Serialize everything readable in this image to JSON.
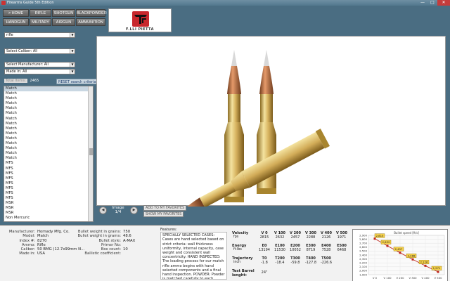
{
  "window": {
    "title": "Firearms Guide 5th Edition",
    "controls": [
      "—",
      "□",
      "✕"
    ]
  },
  "nav": {
    "row1": [
      "> HOME",
      "RIFLE",
      "SHOTGUN",
      "BLACKPOWDER"
    ],
    "row2": [
      "HANDGUN",
      "MILITARY",
      "AIRGUN",
      "AMMUNITION"
    ]
  },
  "logo": {
    "text": "F.LLI PIETTA"
  },
  "filters": {
    "type_select": "rifle",
    "caliber_select": "Select Caliber: All",
    "manufacturer_select": "Select Manufacturer: All",
    "made_in_select": "Made in: All",
    "count_label": "Total Items:",
    "count_value": "2465",
    "reset_label": "RESET search criteria"
  },
  "list": {
    "items": [
      "Match",
      "Match",
      "Match",
      "Match",
      "Match",
      "Match",
      "Match",
      "Match",
      "Match",
      "Match",
      "Match",
      "Match",
      "Match",
      "Match",
      "Match",
      "MFS",
      "MFS",
      "MFS",
      "MFS",
      "MFS",
      "MFS",
      "MFS",
      "MFS",
      "MSR",
      "MSR",
      "MSR",
      "Non Mercuric"
    ],
    "selected_index": 0
  },
  "image_nav": {
    "prev_icon": "chevron-left-icon",
    "next_icon": "chevron-right-icon",
    "caption_line1": "Image",
    "caption_line2": "1/4",
    "add_fav": "ADD TO MY FAVORITES",
    "show_fav": "SHOW MY FAVORITES"
  },
  "specs_left": [
    {
      "k": "Manufacturer:",
      "v": "Hornady Mfg. Co."
    },
    {
      "k": "Model:",
      "v": "Match"
    },
    {
      "k": "Index #:",
      "v": "8270"
    },
    {
      "k": "Ammo:",
      "v": "Rifle"
    },
    {
      "k": "Caliber:",
      "v": "50 BMG (12.7x99mm N..."
    },
    {
      "k": "Made in:",
      "v": "USA"
    }
  ],
  "specs_mid": [
    {
      "k": "Bullet weight in grains:",
      "v": "750"
    },
    {
      "k": "Bullet weight in grams:",
      "v": "48.6"
    },
    {
      "k": "Bullet style:",
      "v": "A-MAX"
    },
    {
      "k": "Primer No:",
      "v": ""
    },
    {
      "k": "Box count:",
      "v": "10"
    },
    {
      "k": "Ballistic coefficient:",
      "v": ""
    }
  ],
  "features": {
    "label": "Features:",
    "text": "SPECIALLY SELECTED CASES: Cases are hand selected based on strict criteria: wall thickness uniformity, internal capacity, case weight and consistent wall concentricity. HAND INSPECTED: The loading process for our match rifle ammo begins with hand selected components and a final hand inspection. POWDER: Powder is matched carefully to each specific"
  },
  "ballistics": {
    "headers": [
      "V 0",
      "V 100",
      "V 200",
      "V 300",
      "V 400",
      "V 500"
    ],
    "velocity_label": "Velocity",
    "velocity_unit": "fps",
    "velocity": [
      "2815",
      "2632",
      "2457",
      "2288",
      "2126",
      "1971"
    ],
    "energy_label": "Energy",
    "energy_unit": "ft·lbs",
    "energy_headers": [
      "E0",
      "E100",
      "E200",
      "E300",
      "E400",
      "E500"
    ],
    "energy": [
      "13194",
      "11530",
      "10052",
      "8719",
      "7528",
      "6468"
    ],
    "trajectory_label": "Trajectory",
    "trajectory_unit": "inch",
    "trajectory_headers": [
      "T0",
      "T200",
      "T300",
      "T400",
      "T500"
    ],
    "trajectory": [
      "-1.8",
      "-18.4",
      "-59.8",
      "-127.8",
      "-226.6"
    ],
    "barrel_label": "Test Barrel lenght:",
    "barrel_value": "24\""
  },
  "chart_data": {
    "type": "line",
    "title": "Bullet speed [ft/s]",
    "categories": [
      "V 0",
      "V 100",
      "V 200",
      "V 300",
      "V 400",
      "V 500"
    ],
    "series": [
      {
        "values": [
          2815,
          2632,
          2457,
          2288,
          2126,
          1971
        ]
      }
    ],
    "ylim": [
      1900,
      2900
    ],
    "yticks": [
      2900,
      2800,
      2700,
      2600,
      2500,
      2400,
      2300,
      2200,
      2100,
      2000,
      1900
    ],
    "data_labels": [
      "2,815",
      "2,632",
      "2,457",
      "2,288",
      "2,126",
      "1,971"
    ],
    "grid": true,
    "colors": {
      "line": "#c0281f",
      "marker_fill": "#f7d24a",
      "marker_stroke": "#8a6a00"
    }
  }
}
